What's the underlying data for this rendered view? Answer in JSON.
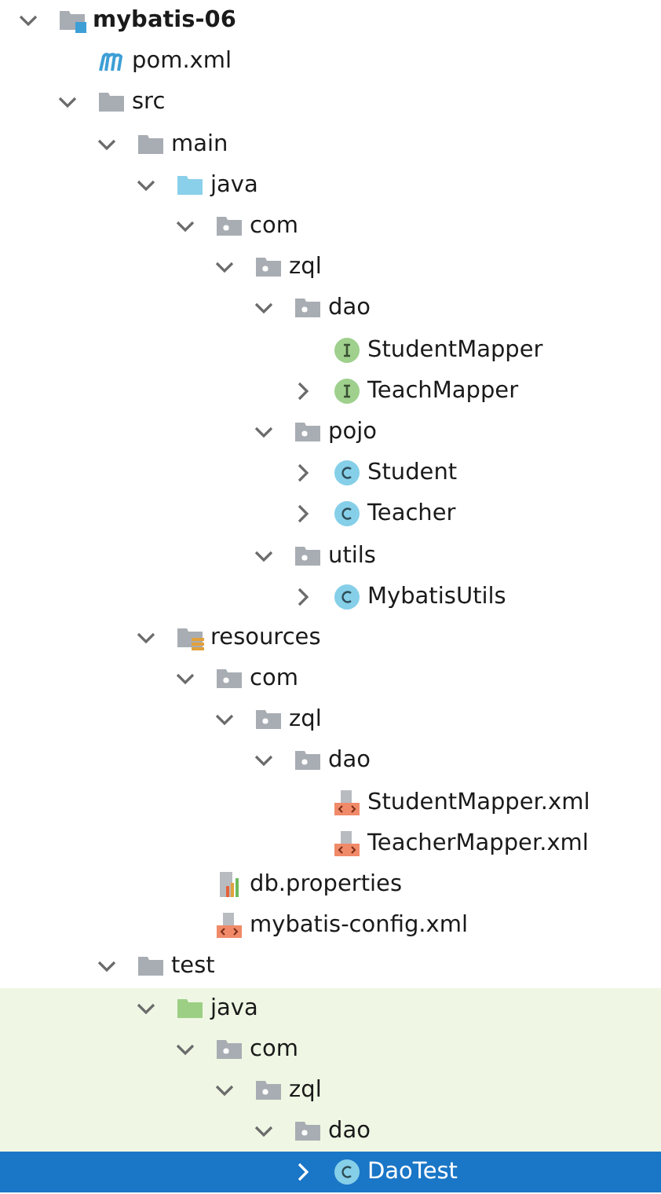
{
  "project_tree": [
    {
      "label": "mybatis-06",
      "kind": "module",
      "expanded": true,
      "selected": false,
      "tinted": false,
      "children": [
        {
          "label": "pom.xml",
          "kind": "maven",
          "selected": false,
          "tinted": false
        },
        {
          "label": "src",
          "kind": "folder",
          "expanded": true,
          "selected": false,
          "tinted": false,
          "children": [
            {
              "label": "main",
              "kind": "folder",
              "expanded": true,
              "selected": false,
              "tinted": false,
              "children": [
                {
                  "label": "java",
                  "kind": "source_folder",
                  "expanded": true,
                  "selected": false,
                  "tinted": false,
                  "children": [
                    {
                      "label": "com",
                      "kind": "package",
                      "expanded": true,
                      "selected": false,
                      "tinted": false,
                      "children": [
                        {
                          "label": "zql",
                          "kind": "package",
                          "expanded": true,
                          "selected": false,
                          "tinted": false,
                          "children": [
                            {
                              "label": "dao",
                              "kind": "package",
                              "expanded": true,
                              "selected": false,
                              "tinted": false,
                              "children": [
                                {
                                  "label": "StudentMapper",
                                  "kind": "interface",
                                  "selected": false,
                                  "tinted": false
                                },
                                {
                                  "label": "TeachMapper",
                                  "kind": "interface",
                                  "expanded": false,
                                  "selected": false,
                                  "tinted": false
                                }
                              ]
                            },
                            {
                              "label": "pojo",
                              "kind": "package",
                              "expanded": true,
                              "selected": false,
                              "tinted": false,
                              "children": [
                                {
                                  "label": "Student",
                                  "kind": "class",
                                  "expanded": false,
                                  "selected": false,
                                  "tinted": false
                                },
                                {
                                  "label": "Teacher",
                                  "kind": "class",
                                  "expanded": false,
                                  "selected": false,
                                  "tinted": false
                                }
                              ]
                            },
                            {
                              "label": "utils",
                              "kind": "package",
                              "expanded": true,
                              "selected": false,
                              "tinted": false,
                              "children": [
                                {
                                  "label": "MybatisUtils",
                                  "kind": "class",
                                  "expanded": false,
                                  "selected": false,
                                  "tinted": false
                                }
                              ]
                            }
                          ]
                        }
                      ]
                    }
                  ]
                },
                {
                  "label": "resources",
                  "kind": "resources_folder",
                  "expanded": true,
                  "selected": false,
                  "tinted": false,
                  "children": [
                    {
                      "label": "com",
                      "kind": "package",
                      "expanded": true,
                      "selected": false,
                      "tinted": false,
                      "children": [
                        {
                          "label": "zql",
                          "kind": "package",
                          "expanded": true,
                          "selected": false,
                          "tinted": false,
                          "children": [
                            {
                              "label": "dao",
                              "kind": "package",
                              "expanded": true,
                              "selected": false,
                              "tinted": false,
                              "children": [
                                {
                                  "label": "StudentMapper.xml",
                                  "kind": "xml",
                                  "selected": false,
                                  "tinted": false
                                },
                                {
                                  "label": "TeacherMapper.xml",
                                  "kind": "xml",
                                  "selected": false,
                                  "tinted": false
                                }
                              ]
                            }
                          ]
                        }
                      ]
                    },
                    {
                      "label": "db.properties",
                      "kind": "properties",
                      "selected": false,
                      "tinted": false
                    },
                    {
                      "label": "mybatis-config.xml",
                      "kind": "xml",
                      "selected": false,
                      "tinted": false
                    }
                  ]
                }
              ]
            },
            {
              "label": "test",
              "kind": "folder",
              "expanded": true,
              "selected": false,
              "tinted": false,
              "children": [
                {
                  "label": "java",
                  "kind": "test_folder",
                  "expanded": true,
                  "selected": false,
                  "tinted": true,
                  "children": [
                    {
                      "label": "com",
                      "kind": "package",
                      "expanded": true,
                      "selected": false,
                      "tinted": true,
                      "children": [
                        {
                          "label": "zql",
                          "kind": "package",
                          "expanded": true,
                          "selected": false,
                          "tinted": true,
                          "children": [
                            {
                              "label": "dao",
                              "kind": "package",
                              "expanded": true,
                              "selected": false,
                              "tinted": true,
                              "children": [
                                {
                                  "label": "DaoTest",
                                  "kind": "class",
                                  "expanded": false,
                                  "selected": true
                                }
                              ]
                            }
                          ]
                        }
                      ]
                    }
                  ]
                }
              ]
            }
          ]
        }
      ]
    }
  ]
}
